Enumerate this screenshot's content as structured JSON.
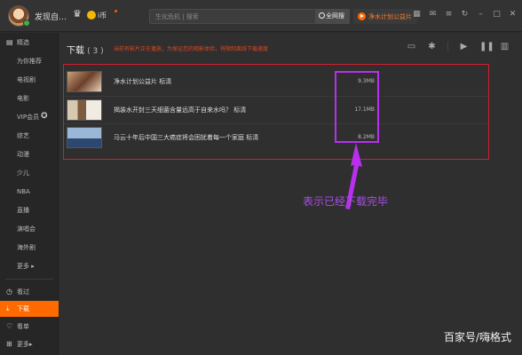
{
  "header": {
    "username": "发现自…",
    "coin_label": "i币",
    "search_placeholder": "生化危机 | 搜索",
    "search_button": "全网搜",
    "promo_label": "净水计划公益片"
  },
  "sidebar": {
    "items": [
      {
        "label": "精选"
      },
      {
        "label": "为你推荐"
      },
      {
        "label": "电视剧"
      },
      {
        "label": "电影"
      },
      {
        "label": "VIP会员"
      },
      {
        "label": "综艺"
      },
      {
        "label": "动漫"
      },
      {
        "label": "少儿"
      },
      {
        "label": "NBA"
      },
      {
        "label": "直播"
      },
      {
        "label": "演唱会"
      },
      {
        "label": "海外剧"
      },
      {
        "label": "更多"
      }
    ],
    "bottom": [
      {
        "label": "看过"
      },
      {
        "label": "下载"
      },
      {
        "label": "看单"
      },
      {
        "label": "更多"
      }
    ]
  },
  "main": {
    "title": "下载",
    "count": "( 3 )",
    "notice": "当前有影片正在播放，为保证您的观影体验，将限制离线下载速度",
    "downloads": [
      {
        "title": "净水计划公益片 标清",
        "size": "9.3MB"
      },
      {
        "title": "揭装水开封三天细菌含量远高于自来水吗？ 标清",
        "size": "17.1MB"
      },
      {
        "title": "马云十年后中国三大癌症将会困扰着每一个家庭 标清",
        "size": "8.2MB"
      }
    ]
  },
  "annotation": "表示已经下载完毕",
  "watermark": "百家号/嗨格式",
  "colors": {
    "accent": "#ff6a00",
    "highlight_box": "#b830ee",
    "list_border": "#d11f2f"
  }
}
